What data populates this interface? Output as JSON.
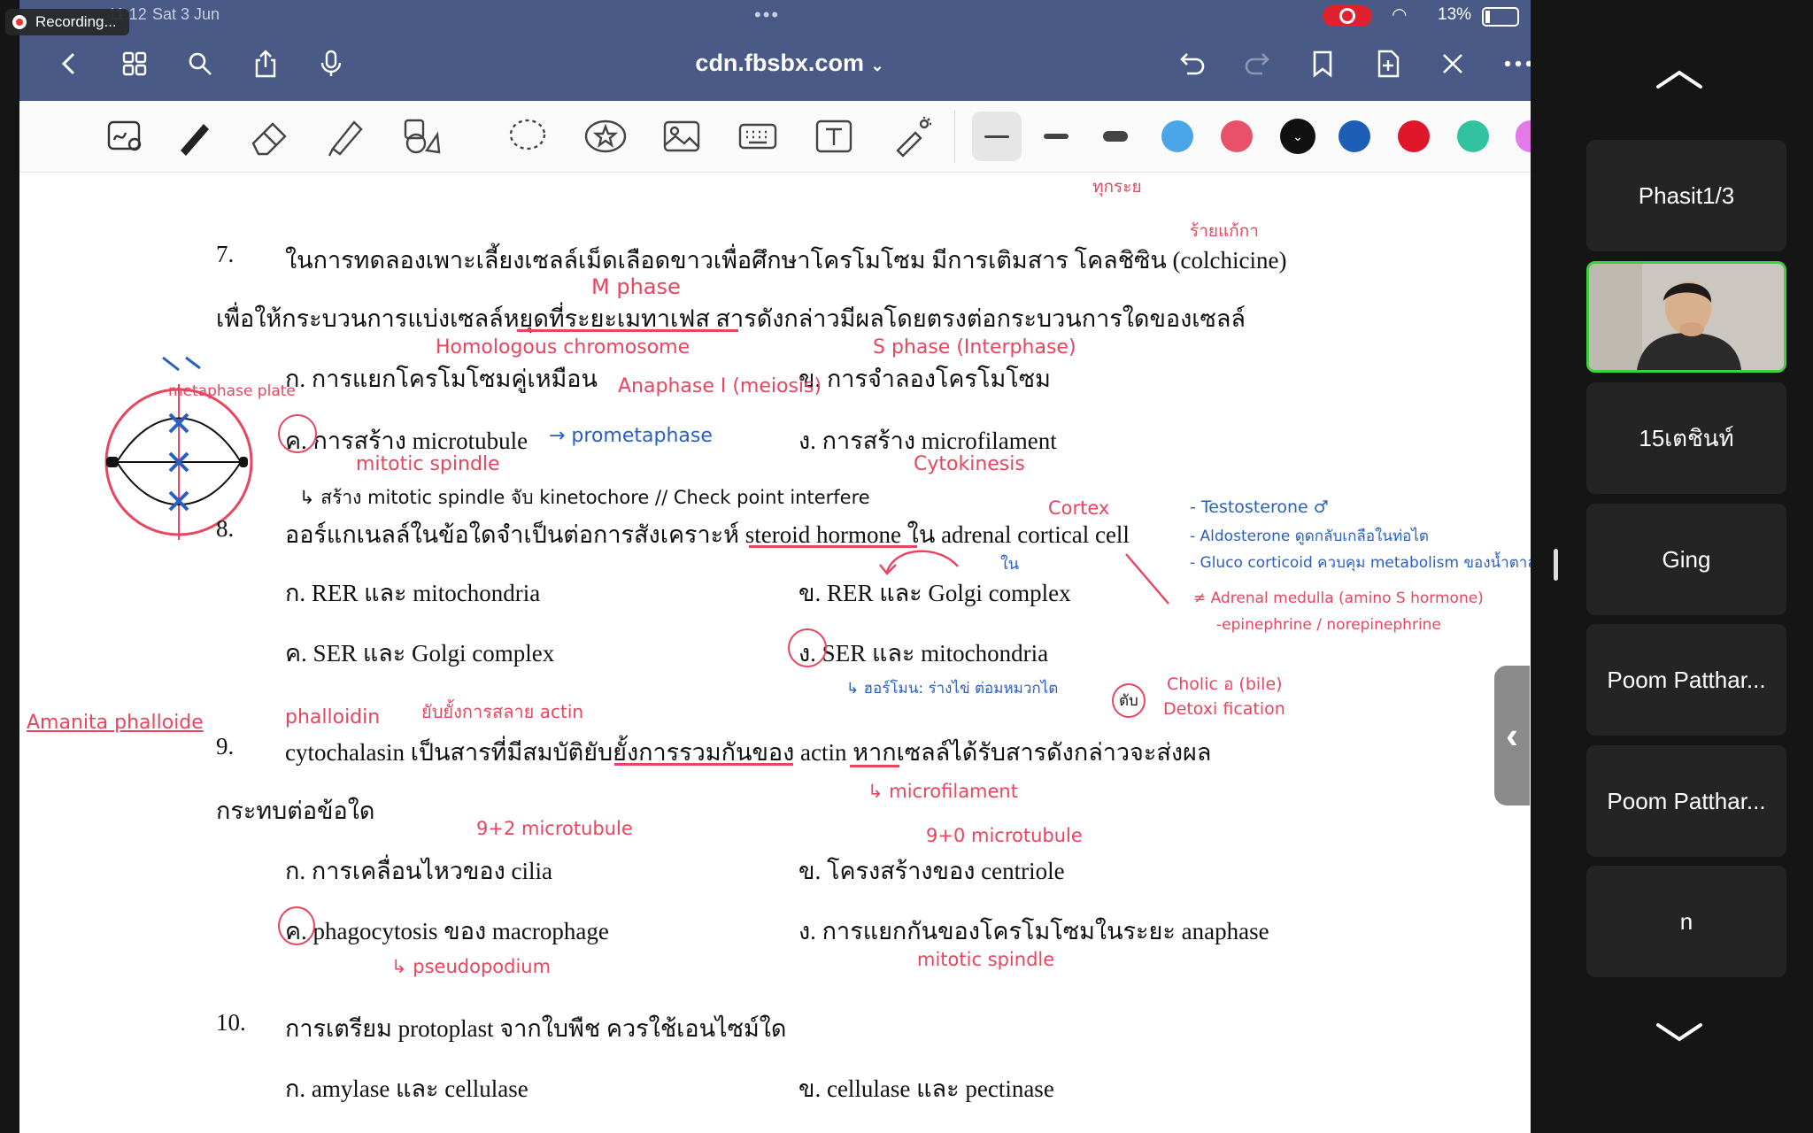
{
  "recording": {
    "label": "Recording..."
  },
  "statusbar": {
    "time": "11:12",
    "date": "Sat 3 Jun",
    "battery": "13%"
  },
  "browser": {
    "url": "cdn.fbsbx.com"
  },
  "toolbar": {
    "colors": [
      "#4aa6e8",
      "#e9506a",
      "#111111",
      "#1d5fb6",
      "#e0162b",
      "#33c2a0",
      "#e37ae8"
    ],
    "selected_color": "#111111"
  },
  "document": {
    "q7": {
      "num": "7.",
      "line1": "ในการทดลองเพาะเลี้ยงเซลล์เม็ดเลือดขาวเพื่อศึกษาโครโมโซม มีการเติมสาร โคลชิซิน (colchicine)",
      "line2": "เพื่อให้กระบวนการแบ่งเซลล์หยุดที่ระยะเมทาเฟส สารดังกล่าวมีผลโดยตรงต่อกระบวนการใดของเซลล์",
      "a": "ก. การแยกโครโมโซมคู่เหมือน",
      "b": "ข. การจำลองโครโมโซม",
      "c": "ค. การสร้าง microtubule",
      "d": "ง. การสร้าง microfilament"
    },
    "q8": {
      "num": "8.",
      "line1": "ออร์แกเนลล์ในข้อใดจำเป็นต่อการสังเคราะห์ steroid hormone ใน adrenal cortical cell",
      "a": "ก. RER และ mitochondria",
      "b": "ข. RER และ Golgi complex",
      "c": "ค. SER และ Golgi complex",
      "d": "ง. SER และ mitochondria"
    },
    "q9": {
      "num": "9.",
      "line1": "cytochalasin เป็นสารที่มีสมบัติยับยั้งการรวมกันของ actin หากเซลล์ได้รับสารดังกล่าวจะส่งผล",
      "line2": "กระทบต่อข้อใด",
      "a": "ก. การเคลื่อนไหวของ cilia",
      "b": "ข. โครงสร้างของ centriole",
      "c": "ค. phagocytosis ของ macrophage",
      "d": "ง. การแยกกันของโครโมโซมในระยะ anaphase"
    },
    "q10": {
      "num": "10.",
      "line1": "การเตรียม protoplast จากใบพืช ควรใช้เอนไซม์ใด",
      "a": "ก. amylase และ cellulase",
      "b": "ข. cellulase และ pectinase"
    }
  },
  "annotations": {
    "top_partial": "ทุกระย",
    "q7_right_top": "ร้ายแก้กา",
    "m_phase": "M phase",
    "homologous": "Homologous chromosome",
    "s_phase": "S phase (Interphase)",
    "anaphase1": "Anaphase I (meiosis)",
    "metaphase_plate": "metaphase plate",
    "prometaphase": "→ prometaphase",
    "mitotic_spindle": "mitotic spindle",
    "cytokinesis": "Cytokinesis",
    "spindle_note": "↳ สร้าง mitotic spindle จับ kinetochore // Check point interfere",
    "cortex": "Cortex",
    "in": "ใน",
    "testosterone": "- Testosterone ♂",
    "aldosterone": "- Aldosterone ดูดกลับเกลือในท่อไต",
    "glucocorticoid": "- Gluco corticoid ควบคุม metabolism ของน้ำตาล",
    "medulla": "≠ Adrenal medulla (amino S hormone)",
    "epinephrine": "-epinephrine / norepinephrine",
    "hormone_note": "↳ ฮอร์โมน: ร่างไข่ ต่อมหมวกไต",
    "liver": "ตับ",
    "cholic": "Cholic อ (bile)",
    "detox": "Detoxi fication",
    "amanita": "Amanita phalloide",
    "phalloidin": "phalloidin",
    "inhibit_actin": "ยับยั้งการสลาย actin",
    "microfilament": "↳ microfilament",
    "micro92": "9+2 microtubule",
    "micro90": "9+0 microtubule",
    "pseudopodium": "↳ pseudopodium",
    "mitotic_spindle2": "mitotic spindle"
  },
  "sidebar": {
    "participants": [
      "Phasit1/3",
      "",
      "15เตชินท์",
      "Ging",
      "Poom Patthar...",
      "Poom Patthar...",
      "n"
    ]
  }
}
